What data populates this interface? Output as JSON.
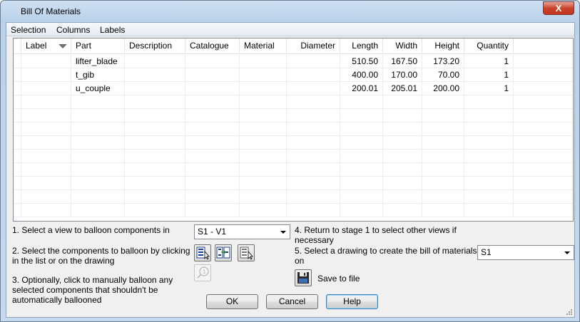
{
  "window": {
    "title": "Bill Of Materials",
    "close_label": "X"
  },
  "menu": [
    "Selection",
    "Columns",
    "Labels"
  ],
  "columns": [
    "Label",
    "Part",
    "Description",
    "Catalogue",
    "Material",
    "Diameter",
    "Length",
    "Width",
    "Height",
    "Quantity"
  ],
  "rows": [
    [
      "",
      "lifter_blade",
      "",
      "",
      "",
      "",
      "510.50",
      "167.50",
      "173.20",
      "1"
    ],
    [
      "",
      "t_gib",
      "",
      "",
      "",
      "",
      "400.00",
      "170.00",
      "70.00",
      "1"
    ],
    [
      "",
      "u_couple",
      "",
      "",
      "",
      "",
      "200.01",
      "205.01",
      "200.00",
      "1"
    ]
  ],
  "steps": {
    "step1": "1. Select a view to balloon components in",
    "step1_select": "S1 - V1",
    "step2": "2. Select the components to balloon by clicking in the list or on the drawing",
    "step3": "3. Optionally, click to manually balloon any selected components that shouldn't be automatically ballooned",
    "step4": "4. Return to stage 1 to select other views if necessary",
    "step5": "5. Select a drawing to create the bill of materials on",
    "step5_select": "S1",
    "save_label": "Save to file"
  },
  "buttons": {
    "ok": "OK",
    "cancel": "Cancel",
    "help": "Help"
  },
  "icons": {
    "select_list": "select-in-list-icon",
    "select_toggle": "select-toggle-icon",
    "select_drawing": "select-on-drawing-icon",
    "manual_balloon": "manual-balloon-icon",
    "save": "floppy-disk-icon"
  },
  "colors": {
    "accent": "#3c7fb1",
    "close": "#c8442c",
    "title_bar": "#b9d1ea"
  }
}
